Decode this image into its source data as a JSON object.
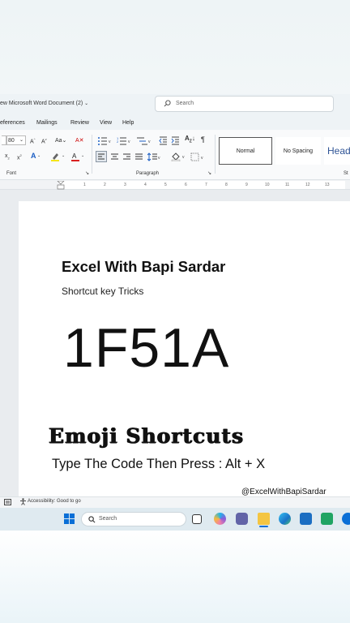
{
  "window": {
    "doc_title": "ew Microsoft Word Document (2)",
    "search_placeholder": "Search"
  },
  "menu": [
    "eferences",
    "Mailings",
    "Review",
    "View",
    "Help"
  ],
  "ribbon": {
    "font_size": "80",
    "groups": [
      "Font",
      "Paragraph",
      "St"
    ],
    "styles": [
      "Normal",
      "No Spacing",
      "Head"
    ]
  },
  "ruler_numbers": [
    "1",
    "2",
    "3",
    "4",
    "5",
    "6",
    "7",
    "8",
    "9",
    "10",
    "11",
    "12",
    "13"
  ],
  "document": {
    "heading": "Excel With Bapi Sardar",
    "subheading": "Shortcut key Tricks",
    "code": "1F51A"
  },
  "overlay": {
    "title": "Emoji Shortcuts",
    "instruction": "Type The Code Then Press : Alt + X",
    "watermark": "@ExcelWithBapiSardar"
  },
  "statusbar": {
    "accessibility": "Accessibility: Good to go"
  },
  "taskbar": {
    "search_placeholder": "Search",
    "icons": [
      "windows-start",
      "task-view",
      "copilot",
      "teams",
      "file-explorer",
      "edge",
      "store",
      "excel"
    ]
  },
  "colors": {
    "accent": "#2b6cb0",
    "word_blue": "#185abd",
    "heading3": "#2f5496"
  }
}
